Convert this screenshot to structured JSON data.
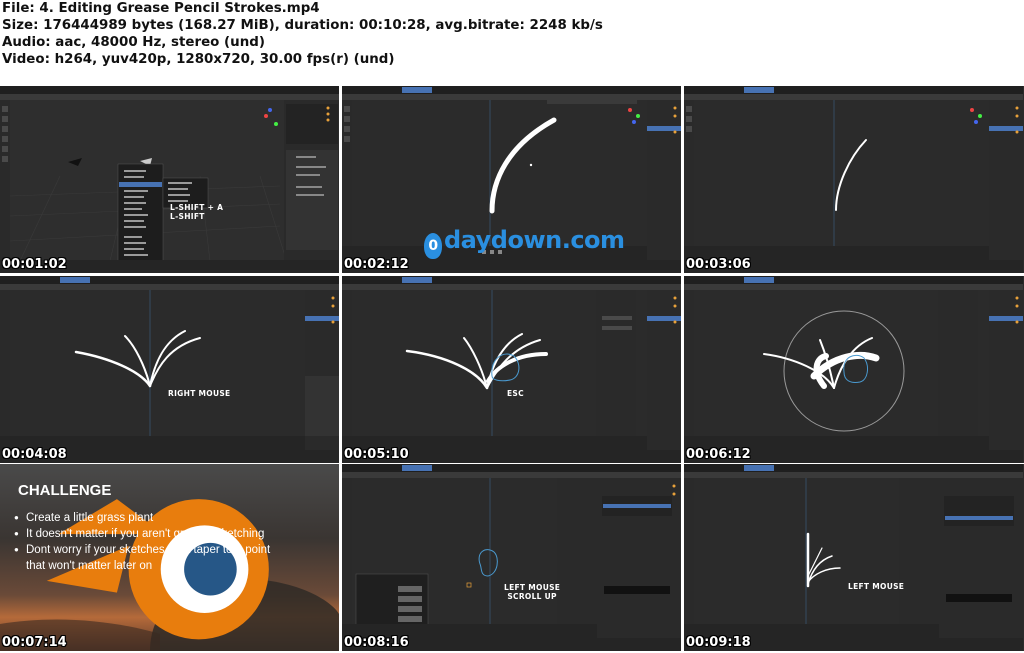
{
  "header": {
    "file_line": "File: 4. Editing Grease Pencil Strokes.mp4",
    "size_line": "Size: 176444989 bytes (168.27 MiB), duration: 00:10:28, avg.bitrate: 2248 kb/s",
    "audio_line": "Audio: aac, 48000 Hz, stereo (und)",
    "video_line": "Video: h264, yuv420p, 1280x720, 30.00 fps(r) (und)"
  },
  "thumbnails": [
    {
      "timestamp": "00:01:02",
      "caption_a": "L-SHIFT + A",
      "caption_b": "L-SHIFT"
    },
    {
      "timestamp": "00:02:12"
    },
    {
      "timestamp": "00:03:06"
    },
    {
      "timestamp": "00:04:08",
      "caption": "RIGHT MOUSE"
    },
    {
      "timestamp": "00:05:10",
      "caption": "ESC"
    },
    {
      "timestamp": "00:06:12"
    },
    {
      "timestamp": "00:07:14"
    },
    {
      "timestamp": "00:08:16",
      "caption_a": "LEFT MOUSE",
      "caption_b": "SCROLL UP"
    },
    {
      "timestamp": "00:09:18",
      "caption": "LEFT MOUSE"
    }
  ],
  "challenge": {
    "title": "CHALLENGE",
    "item1": "Create a little grass plant",
    "item2": "It doesn't matter if you aren't great at sketching",
    "item3a": "Dont worry if your sketches dont taper to a point",
    "item3b": "that won't matter later on"
  },
  "watermark": {
    "logo_glyph": "0",
    "text": "daydown.com"
  },
  "colors": {
    "viewport": "#2b2b2b",
    "ui_bar": "#3d3d3d",
    "accent": "#4772b3",
    "watermark": "#2a8fe0"
  }
}
